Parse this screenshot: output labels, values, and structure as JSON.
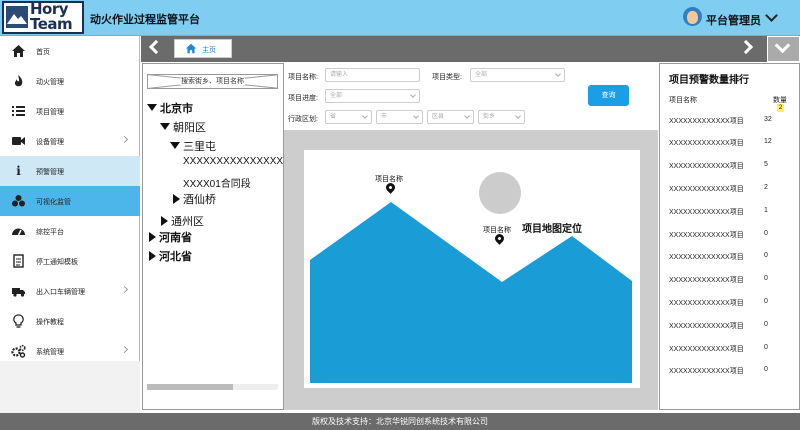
{
  "header": {
    "logo_line1": "Hory",
    "logo_line2": "Team",
    "app_title": "动火作业过程监管平台",
    "username": "平台管理员"
  },
  "sidebar": {
    "items": [
      {
        "label": "首页",
        "icon": "home-icon"
      },
      {
        "label": "动火管理",
        "icon": "flame-icon"
      },
      {
        "label": "项目管理",
        "icon": "list-icon"
      },
      {
        "label": "设备管理",
        "icon": "camera-icon"
      },
      {
        "label": "预警管理",
        "icon": "info-icon"
      },
      {
        "label": "可视化监管",
        "icon": "cubes-icon"
      },
      {
        "label": "综控平台",
        "icon": "dashboard-icon"
      },
      {
        "label": "停工通知模板",
        "icon": "document-icon"
      },
      {
        "label": "出入口车辆管理",
        "icon": "truck-icon"
      },
      {
        "label": "操作教程",
        "icon": "lightbulb-icon"
      },
      {
        "label": "系统管理",
        "icon": "gears-icon"
      }
    ]
  },
  "tabs": {
    "home_label": "主页"
  },
  "tree": {
    "search_placeholder": "搜索街乡、项目名称",
    "nodes": {
      "beijing": "北京市",
      "chaoyang": "朝阳区",
      "sanlitun": "三里屯",
      "project1": "XXXXXXXXXXXXXXXXXX",
      "project2": "XXXX01合同段",
      "jiuxianqiao": "酒仙桥",
      "tongzhou": "通州区",
      "henan": "河南省",
      "hebei": "河北省"
    }
  },
  "filters": {
    "project_name_label": "项目名称:",
    "project_name_placeholder": "请输入",
    "project_type_label": "项目类型:",
    "project_type_value": "全部",
    "progress_label": "项目进度:",
    "progress_value": "全部",
    "region_label": "行政区划:",
    "province_value": "省",
    "city_value": "市",
    "district_value": "区县",
    "street_value": "街乡",
    "query_button": "查询"
  },
  "map": {
    "title": "项目地图定位",
    "pin1_label": "项目名称",
    "pin2_label": "项目名称",
    "colors": {
      "terrain": "#1a9cd6",
      "sun": "#cccccc"
    }
  },
  "ranking": {
    "title": "项目预警数量排行",
    "col_name": "项目名称",
    "col_count": "数量",
    "badge": "2",
    "rows": [
      {
        "name": "XXXXXXXXXXXXX项目",
        "count": "32"
      },
      {
        "name": "XXXXXXXXXXXXX项目",
        "count": "12"
      },
      {
        "name": "XXXXXXXXXXXXX项目",
        "count": "5"
      },
      {
        "name": "XXXXXXXXXXXXX项目",
        "count": "2"
      },
      {
        "name": "XXXXXXXXXXXXX项目",
        "count": "1"
      },
      {
        "name": "XXXXXXXXXXXXX项目",
        "count": "0"
      },
      {
        "name": "XXXXXXXXXXXXX项目",
        "count": "0"
      },
      {
        "name": "XXXXXXXXXXXXX项目",
        "count": "0"
      },
      {
        "name": "XXXXXXXXXXXXX项目",
        "count": "0"
      },
      {
        "name": "XXXXXXXXXXXXX项目",
        "count": "0"
      },
      {
        "name": "XXXXXXXXXXXXX项目",
        "count": "0"
      },
      {
        "name": "XXXXXXXXXXXXX项目",
        "count": "0"
      }
    ]
  },
  "footer": {
    "text": "版权及技术支持：北京华锐同创系统技术有限公司"
  }
}
